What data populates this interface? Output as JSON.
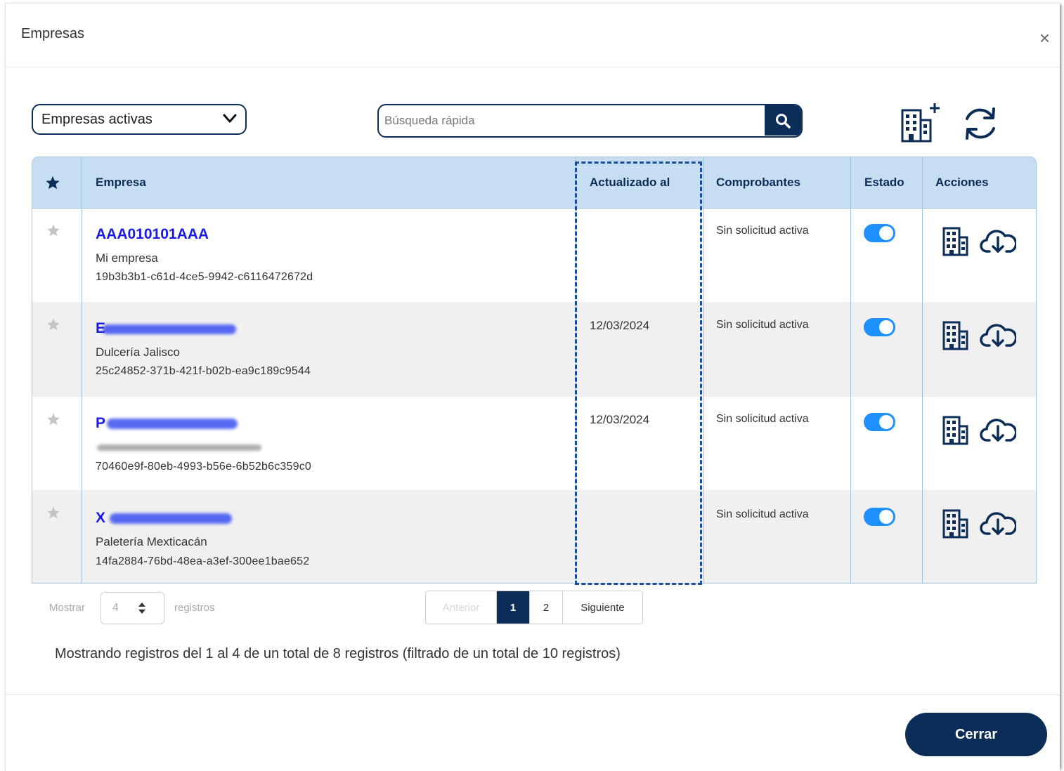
{
  "modal": {
    "title": "Empresas",
    "close_symbol": "×"
  },
  "filter": {
    "selected": "Empresas activas"
  },
  "search": {
    "placeholder": "Búsqueda rápida"
  },
  "table": {
    "headers": {
      "favorite_icon": "star-icon",
      "empresa": "Empresa",
      "actualizado": "Actualizado al",
      "comprobantes": "Comprobantes",
      "estado": "Estado",
      "acciones": "Acciones"
    },
    "rows": [
      {
        "rfc": "AAA010101AAA",
        "name": "Mi empresa",
        "uuid": "19b3b3b1-c61d-4ce5-9942-c6116472672d",
        "updated": "",
        "comprobantes": "Sin solicitud activa",
        "active": true
      },
      {
        "rfc": "E",
        "name": "Dulcería Jalisco",
        "uuid": "25c24852-371b-421f-b02b-ea9c189c9544",
        "updated": "12/03/2024",
        "comprobantes": "Sin solicitud activa",
        "active": true
      },
      {
        "rfc": "P",
        "name": "",
        "uuid": "70460e9f-80eb-4993-b56e-6b52b6c359c0",
        "updated": "12/03/2024",
        "comprobantes": "Sin solicitud activa",
        "active": true
      },
      {
        "rfc": "X",
        "name": "Paletería Mexticacán",
        "uuid": "14fa2884-76bd-48ea-a3ef-300ee1bae652",
        "updated": "",
        "comprobantes": "Sin solicitud activa",
        "active": true
      }
    ]
  },
  "pagination": {
    "show_label": "Mostrar",
    "page_size": "4",
    "records_label": "registros",
    "prev": "Anterior",
    "pages": [
      "1",
      "2"
    ],
    "next": "Siguiente",
    "current_page": "1"
  },
  "summary": "Mostrando registros del 1 al 4 de un total de 8 registros (filtrado de un total de 10 registros)",
  "footer": {
    "close_label": "Cerrar"
  },
  "colors": {
    "primary": "#0c2d57",
    "header_bg": "#c6ddf2",
    "link": "#1a1ae8",
    "toggle_on": "#1e90ff"
  }
}
